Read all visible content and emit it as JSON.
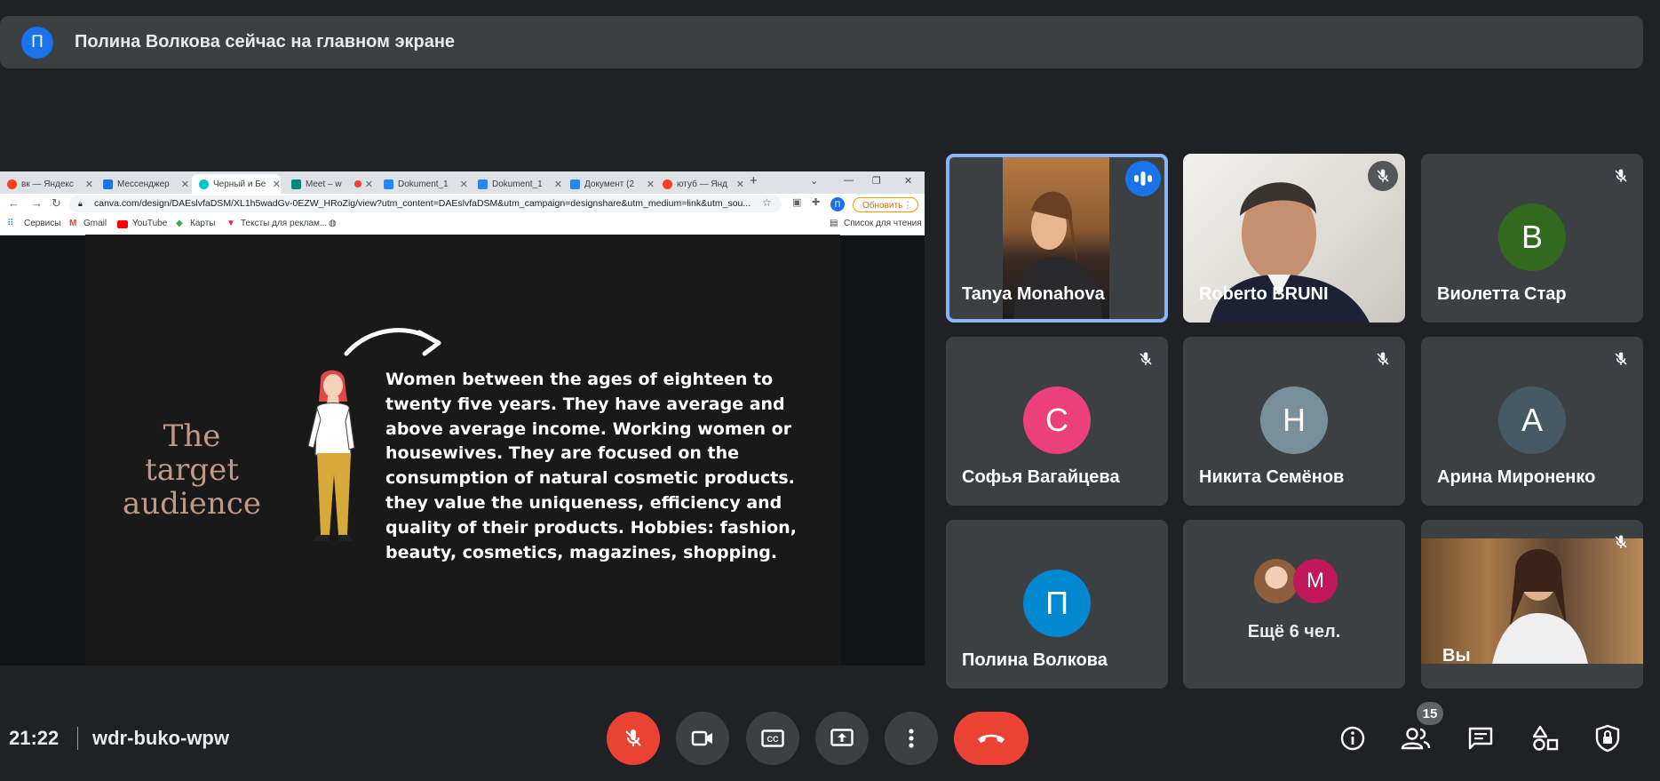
{
  "notice": {
    "avatar_letter": "П",
    "text": "Полина Волкова сейчас на главном экране"
  },
  "browser": {
    "tabs": [
      "вк — Яндекс",
      "Мессенджер",
      "Черный и Бе",
      "Meet – w",
      "Dokument_1",
      "Dokument_1",
      "Документ (2",
      "ютуб — Янд"
    ],
    "url": "canva.com/design/DAEslvfaDSM/XL1h5wadGv-0EZW_HRoZig/view?utm_content=DAEslvfaDSM&utm_campaign=designshare&utm_medium=link&utm_sou...",
    "update_button": "Обновить",
    "profile_letter": "П",
    "bookmarks": [
      "Сервисы",
      "Gmail",
      "YouTube",
      "Карты",
      "Тексты для реклам..."
    ],
    "reading_list": "Список для чтения"
  },
  "slide": {
    "title_line1": "The target",
    "title_line2": "audience",
    "body": "Women between the ages of  eighteen to twenty five years. They  have average and above average income.  Working women or housewives.  They are focused on the consumption of natural cosmetic products.  they value the uniqueness, efficiency and quality of their products.  Hobbies: fashion, beauty, cosmetics, magazines, shopping."
  },
  "participants": [
    {
      "name": "Tanya Monahova",
      "mic": "speaking",
      "video": true
    },
    {
      "name": "Roberto BRUNI",
      "mic": "muted",
      "video": true
    },
    {
      "name": "Виолетта Стар",
      "mic": "muted",
      "letter": "В",
      "color": "#33691e"
    },
    {
      "name": "Софья Вагайцева",
      "mic": "muted",
      "letter": "С",
      "color": "#ec407a"
    },
    {
      "name": "Никита Семёнов",
      "mic": "muted",
      "letter": "Н",
      "color": "#78909c"
    },
    {
      "name": "Арина Мироненко",
      "mic": "muted",
      "letter": "А",
      "color": "#455a64"
    },
    {
      "name": "Полина Волкова",
      "letter": "П",
      "color": "#0288d1"
    },
    {
      "more_label": "Ещё 6 чел.",
      "letter": "М",
      "color": "#c2185b"
    },
    {
      "name": "Вы",
      "mic": "muted",
      "video": true
    }
  ],
  "bottom": {
    "time": "21:22",
    "meeting_code": "wdr-buko-wpw",
    "people_count": "15"
  },
  "colors": {
    "bg": "#202124",
    "tile": "#3c4043",
    "danger": "#ea4335",
    "accent": "#1a73e8"
  }
}
